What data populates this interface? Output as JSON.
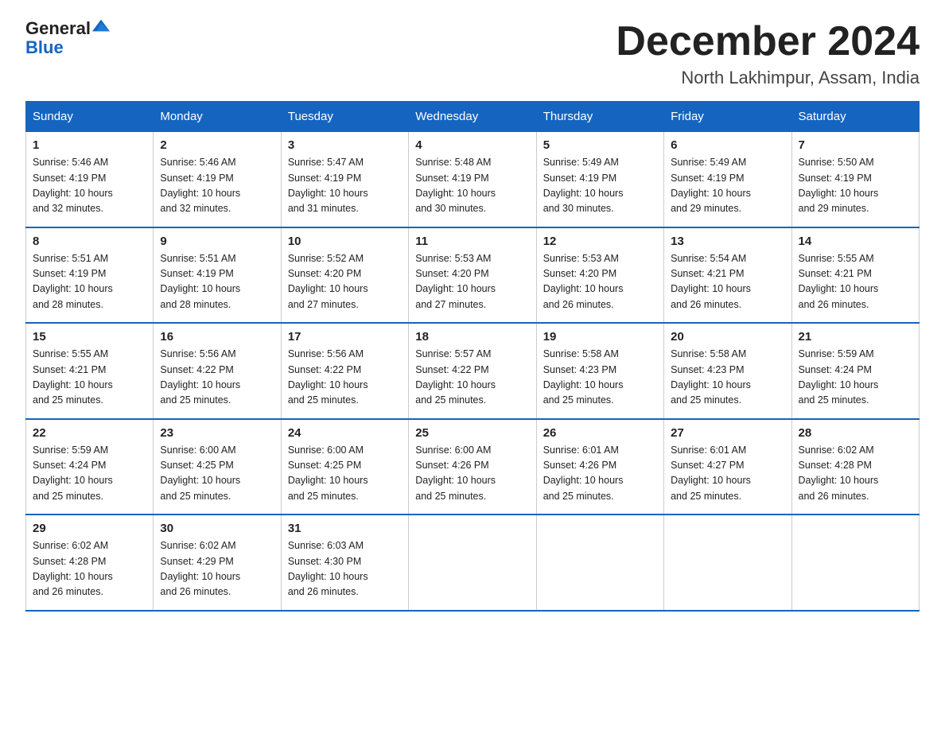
{
  "header": {
    "logo_general": "General",
    "logo_blue": "Blue",
    "month_year": "December 2024",
    "location": "North Lakhimpur, Assam, India"
  },
  "days_of_week": [
    "Sunday",
    "Monday",
    "Tuesday",
    "Wednesday",
    "Thursday",
    "Friday",
    "Saturday"
  ],
  "weeks": [
    [
      {
        "day": "1",
        "info": "Sunrise: 5:46 AM\nSunset: 4:19 PM\nDaylight: 10 hours\nand 32 minutes."
      },
      {
        "day": "2",
        "info": "Sunrise: 5:46 AM\nSunset: 4:19 PM\nDaylight: 10 hours\nand 32 minutes."
      },
      {
        "day": "3",
        "info": "Sunrise: 5:47 AM\nSunset: 4:19 PM\nDaylight: 10 hours\nand 31 minutes."
      },
      {
        "day": "4",
        "info": "Sunrise: 5:48 AM\nSunset: 4:19 PM\nDaylight: 10 hours\nand 30 minutes."
      },
      {
        "day": "5",
        "info": "Sunrise: 5:49 AM\nSunset: 4:19 PM\nDaylight: 10 hours\nand 30 minutes."
      },
      {
        "day": "6",
        "info": "Sunrise: 5:49 AM\nSunset: 4:19 PM\nDaylight: 10 hours\nand 29 minutes."
      },
      {
        "day": "7",
        "info": "Sunrise: 5:50 AM\nSunset: 4:19 PM\nDaylight: 10 hours\nand 29 minutes."
      }
    ],
    [
      {
        "day": "8",
        "info": "Sunrise: 5:51 AM\nSunset: 4:19 PM\nDaylight: 10 hours\nand 28 minutes."
      },
      {
        "day": "9",
        "info": "Sunrise: 5:51 AM\nSunset: 4:19 PM\nDaylight: 10 hours\nand 28 minutes."
      },
      {
        "day": "10",
        "info": "Sunrise: 5:52 AM\nSunset: 4:20 PM\nDaylight: 10 hours\nand 27 minutes."
      },
      {
        "day": "11",
        "info": "Sunrise: 5:53 AM\nSunset: 4:20 PM\nDaylight: 10 hours\nand 27 minutes."
      },
      {
        "day": "12",
        "info": "Sunrise: 5:53 AM\nSunset: 4:20 PM\nDaylight: 10 hours\nand 26 minutes."
      },
      {
        "day": "13",
        "info": "Sunrise: 5:54 AM\nSunset: 4:21 PM\nDaylight: 10 hours\nand 26 minutes."
      },
      {
        "day": "14",
        "info": "Sunrise: 5:55 AM\nSunset: 4:21 PM\nDaylight: 10 hours\nand 26 minutes."
      }
    ],
    [
      {
        "day": "15",
        "info": "Sunrise: 5:55 AM\nSunset: 4:21 PM\nDaylight: 10 hours\nand 25 minutes."
      },
      {
        "day": "16",
        "info": "Sunrise: 5:56 AM\nSunset: 4:22 PM\nDaylight: 10 hours\nand 25 minutes."
      },
      {
        "day": "17",
        "info": "Sunrise: 5:56 AM\nSunset: 4:22 PM\nDaylight: 10 hours\nand 25 minutes."
      },
      {
        "day": "18",
        "info": "Sunrise: 5:57 AM\nSunset: 4:22 PM\nDaylight: 10 hours\nand 25 minutes."
      },
      {
        "day": "19",
        "info": "Sunrise: 5:58 AM\nSunset: 4:23 PM\nDaylight: 10 hours\nand 25 minutes."
      },
      {
        "day": "20",
        "info": "Sunrise: 5:58 AM\nSunset: 4:23 PM\nDaylight: 10 hours\nand 25 minutes."
      },
      {
        "day": "21",
        "info": "Sunrise: 5:59 AM\nSunset: 4:24 PM\nDaylight: 10 hours\nand 25 minutes."
      }
    ],
    [
      {
        "day": "22",
        "info": "Sunrise: 5:59 AM\nSunset: 4:24 PM\nDaylight: 10 hours\nand 25 minutes."
      },
      {
        "day": "23",
        "info": "Sunrise: 6:00 AM\nSunset: 4:25 PM\nDaylight: 10 hours\nand 25 minutes."
      },
      {
        "day": "24",
        "info": "Sunrise: 6:00 AM\nSunset: 4:25 PM\nDaylight: 10 hours\nand 25 minutes."
      },
      {
        "day": "25",
        "info": "Sunrise: 6:00 AM\nSunset: 4:26 PM\nDaylight: 10 hours\nand 25 minutes."
      },
      {
        "day": "26",
        "info": "Sunrise: 6:01 AM\nSunset: 4:26 PM\nDaylight: 10 hours\nand 25 minutes."
      },
      {
        "day": "27",
        "info": "Sunrise: 6:01 AM\nSunset: 4:27 PM\nDaylight: 10 hours\nand 25 minutes."
      },
      {
        "day": "28",
        "info": "Sunrise: 6:02 AM\nSunset: 4:28 PM\nDaylight: 10 hours\nand 26 minutes."
      }
    ],
    [
      {
        "day": "29",
        "info": "Sunrise: 6:02 AM\nSunset: 4:28 PM\nDaylight: 10 hours\nand 26 minutes."
      },
      {
        "day": "30",
        "info": "Sunrise: 6:02 AM\nSunset: 4:29 PM\nDaylight: 10 hours\nand 26 minutes."
      },
      {
        "day": "31",
        "info": "Sunrise: 6:03 AM\nSunset: 4:30 PM\nDaylight: 10 hours\nand 26 minutes."
      },
      {
        "day": "",
        "info": ""
      },
      {
        "day": "",
        "info": ""
      },
      {
        "day": "",
        "info": ""
      },
      {
        "day": "",
        "info": ""
      }
    ]
  ]
}
